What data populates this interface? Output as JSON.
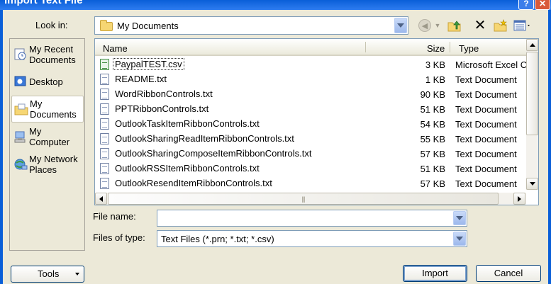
{
  "window": {
    "title": "Import Text File",
    "help_glyph": "?",
    "close_glyph": "✕"
  },
  "lookin": {
    "label": "Look in:",
    "value": "My Documents"
  },
  "toolbar": {
    "back_icon": "back-arrow-icon",
    "up_icon": "up-one-level-icon",
    "delete_icon": "delete-icon",
    "newfolder_icon": "new-folder-icon",
    "views_icon": "views-menu-icon"
  },
  "places": [
    {
      "label": "My Recent Documents",
      "icon": "recent-documents-icon"
    },
    {
      "label": "Desktop",
      "icon": "desktop-icon"
    },
    {
      "label": "My Documents",
      "icon": "my-documents-icon",
      "selected": true
    },
    {
      "label": "My Computer",
      "icon": "my-computer-icon"
    },
    {
      "label": "My Network Places",
      "icon": "network-places-icon"
    }
  ],
  "filelist": {
    "columns": {
      "name": "Name",
      "size": "Size",
      "type": "Type"
    },
    "rows": [
      {
        "name": "PaypalTEST.csv",
        "size": "3 KB",
        "type": "Microsoft Excel C",
        "icon": "excel-csv-icon",
        "selected": true
      },
      {
        "name": "README.txt",
        "size": "1 KB",
        "type": "Text Document",
        "icon": "text-document-icon"
      },
      {
        "name": "WordRibbonControls.txt",
        "size": "90 KB",
        "type": "Text Document",
        "icon": "text-document-icon"
      },
      {
        "name": "PPTRibbonControls.txt",
        "size": "51 KB",
        "type": "Text Document",
        "icon": "text-document-icon"
      },
      {
        "name": "OutlookTaskItemRibbonControls.txt",
        "size": "54 KB",
        "type": "Text Document",
        "icon": "text-document-icon"
      },
      {
        "name": "OutlookSharingReadItemRibbonControls.txt",
        "size": "55 KB",
        "type": "Text Document",
        "icon": "text-document-icon"
      },
      {
        "name": "OutlookSharingComposeItemRibbonControls.txt",
        "size": "57 KB",
        "type": "Text Document",
        "icon": "text-document-icon"
      },
      {
        "name": "OutlookRSSItemRibbonControls.txt",
        "size": "51 KB",
        "type": "Text Document",
        "icon": "text-document-icon"
      },
      {
        "name": "OutlookResendItemRibbonControls.txt",
        "size": "57 KB",
        "type": "Text Document",
        "icon": "text-document-icon"
      }
    ]
  },
  "filename": {
    "label": "File name:",
    "value": ""
  },
  "filetype": {
    "label": "Files of type:",
    "value": "Text Files (*.prn; *.txt; *.csv)"
  },
  "buttons": {
    "tools": "Tools",
    "import": "Import",
    "cancel": "Cancel"
  },
  "colors": {
    "dialog_bg": "#ECE9D8",
    "titlebar": "#0A5FD8",
    "button_border": "#003C74"
  }
}
